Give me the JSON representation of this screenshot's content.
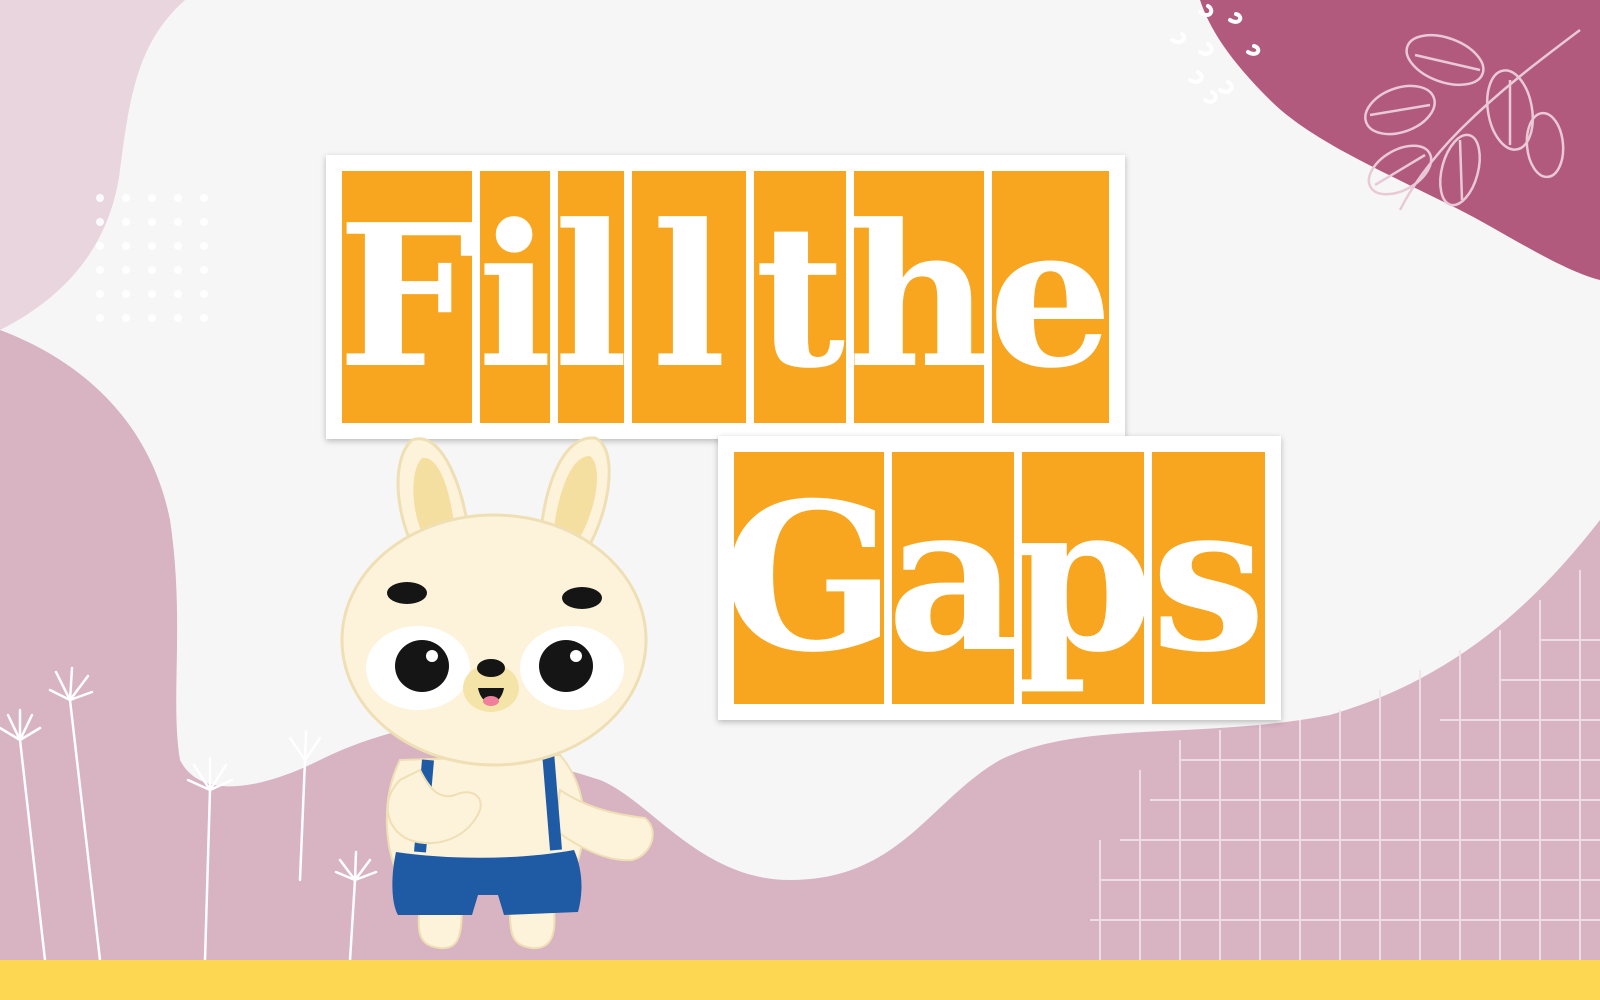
{
  "title": {
    "line1": [
      "F",
      "i",
      "l",
      "l",
      "t",
      "h",
      "e"
    ],
    "line2": [
      "G",
      "a",
      "p",
      "s"
    ]
  },
  "colors": {
    "tile": "#f8a61f",
    "tile_text": "#ffffff",
    "panel": "#ffffff",
    "background_light": "#f6f6f6",
    "blob_pink": "#d8b3c2",
    "blob_light_pink": "#e8d5dd",
    "blob_magenta": "#b15a7d",
    "ground": "#fdd652",
    "bunny_fur": "#fdf3da",
    "bunny_ears_inner": "#f5dfa0",
    "overalls": "#1f5aa5"
  },
  "character": {
    "name": "bunny-mascot",
    "icon": "bunny-icon"
  },
  "decorations": [
    "dot-grid",
    "grass-doodles",
    "leaf-branch",
    "grid-pattern",
    "swirl-marks"
  ]
}
